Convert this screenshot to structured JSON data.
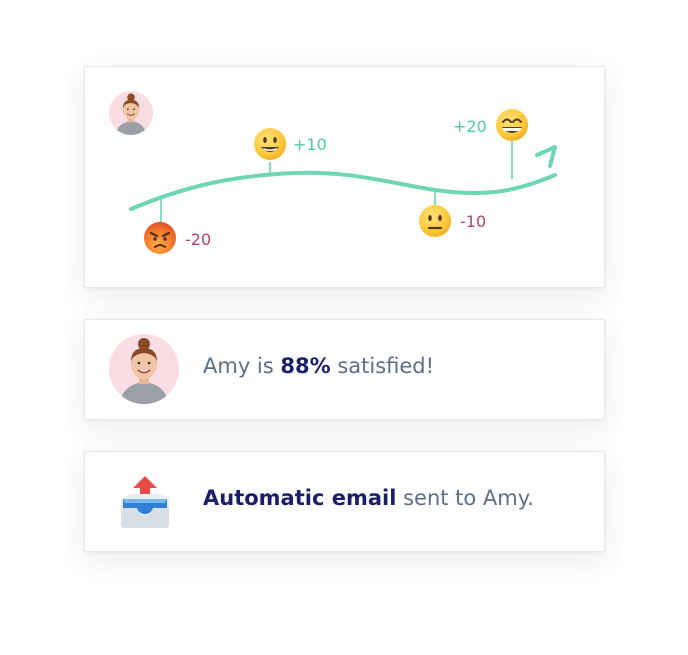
{
  "journey": {
    "points": [
      {
        "score": "-20",
        "mood": "angry",
        "color": "#b5456a"
      },
      {
        "score": "+10",
        "mood": "happy",
        "color": "#4ec9a8"
      },
      {
        "score": "-10",
        "mood": "neutral",
        "color": "#b5456a"
      },
      {
        "score": "+20",
        "mood": "grinning",
        "color": "#4ec9a8"
      }
    ],
    "curve_color": "#6ed6b4"
  },
  "satisfaction": {
    "prefix": "Amy is ",
    "percent": "88%",
    "suffix": " satisfied!"
  },
  "email": {
    "bold": "Automatic email",
    "rest": " sent to Amy."
  },
  "colors": {
    "text_muted": "#5c6f89",
    "text_strong": "#1b1f6b",
    "positive": "#4ec9a8",
    "negative": "#b5456a"
  },
  "icons": [
    "avatar-amy",
    "angry-face-icon",
    "smiling-face-icon",
    "neutral-face-icon",
    "grinning-face-icon",
    "outbox-tray-icon"
  ]
}
